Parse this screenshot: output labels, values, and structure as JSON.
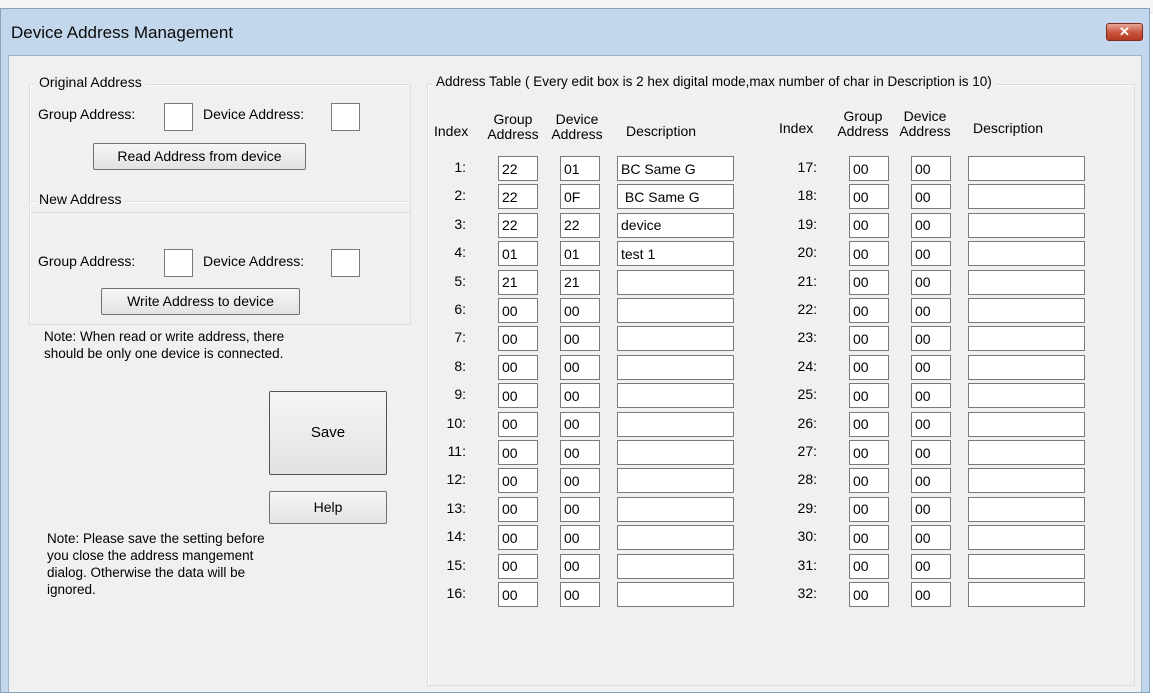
{
  "window": {
    "title": "Device Address Management",
    "close_glyph": "✕"
  },
  "original_address": {
    "legend": "Original Address",
    "group_label": "Group Address:",
    "group_value": "",
    "device_label": "Device Address:",
    "device_value": "",
    "read_button": "Read Address from device"
  },
  "new_address": {
    "legend": "New Address",
    "group_label": "Group Address:",
    "group_value": "",
    "device_label": "Device Address:",
    "device_value": "",
    "write_button": "Write Address to device"
  },
  "note1": [
    "Note: When read or write address, there",
    "should be only one device is connected."
  ],
  "save_button": "Save",
  "help_button": "Help",
  "note2": [
    "Note: Please save the setting before",
    "you close the address mangement",
    "dialog. Otherwise the data will be",
    "ignored."
  ],
  "address_table": {
    "legend": "Address Table ( Every edit box is 2 hex digital mode,max number of char in Description is 10)",
    "headers": {
      "index": "Index",
      "group_line1": "Group",
      "group_line2": "Address",
      "device_line1": "Device",
      "device_line2": "Address",
      "description": "Description"
    },
    "left_rows": [
      {
        "index": "1:",
        "group": "22",
        "device": "01",
        "desc": "BC Same G"
      },
      {
        "index": "2:",
        "group": "22",
        "device": "0F",
        "desc": " BC Same G"
      },
      {
        "index": "3:",
        "group": "22",
        "device": "22",
        "desc": "device"
      },
      {
        "index": "4:",
        "group": "01",
        "device": "01",
        "desc": "test 1"
      },
      {
        "index": "5:",
        "group": "21",
        "device": "21",
        "desc": ""
      },
      {
        "index": "6:",
        "group": "00",
        "device": "00",
        "desc": ""
      },
      {
        "index": "7:",
        "group": "00",
        "device": "00",
        "desc": ""
      },
      {
        "index": "8:",
        "group": "00",
        "device": "00",
        "desc": ""
      },
      {
        "index": "9:",
        "group": "00",
        "device": "00",
        "desc": ""
      },
      {
        "index": "10:",
        "group": "00",
        "device": "00",
        "desc": ""
      },
      {
        "index": "11:",
        "group": "00",
        "device": "00",
        "desc": ""
      },
      {
        "index": "12:",
        "group": "00",
        "device": "00",
        "desc": ""
      },
      {
        "index": "13:",
        "group": "00",
        "device": "00",
        "desc": ""
      },
      {
        "index": "14:",
        "group": "00",
        "device": "00",
        "desc": ""
      },
      {
        "index": "15:",
        "group": "00",
        "device": "00",
        "desc": ""
      },
      {
        "index": "16:",
        "group": "00",
        "device": "00",
        "desc": ""
      }
    ],
    "right_rows": [
      {
        "index": "17:",
        "group": "00",
        "device": "00",
        "desc": ""
      },
      {
        "index": "18:",
        "group": "00",
        "device": "00",
        "desc": ""
      },
      {
        "index": "19:",
        "group": "00",
        "device": "00",
        "desc": ""
      },
      {
        "index": "20:",
        "group": "00",
        "device": "00",
        "desc": ""
      },
      {
        "index": "21:",
        "group": "00",
        "device": "00",
        "desc": ""
      },
      {
        "index": "22:",
        "group": "00",
        "device": "00",
        "desc": ""
      },
      {
        "index": "23:",
        "group": "00",
        "device": "00",
        "desc": ""
      },
      {
        "index": "24:",
        "group": "00",
        "device": "00",
        "desc": ""
      },
      {
        "index": "25:",
        "group": "00",
        "device": "00",
        "desc": ""
      },
      {
        "index": "26:",
        "group": "00",
        "device": "00",
        "desc": ""
      },
      {
        "index": "27:",
        "group": "00",
        "device": "00",
        "desc": ""
      },
      {
        "index": "28:",
        "group": "00",
        "device": "00",
        "desc": ""
      },
      {
        "index": "29:",
        "group": "00",
        "device": "00",
        "desc": ""
      },
      {
        "index": "30:",
        "group": "00",
        "device": "00",
        "desc": ""
      },
      {
        "index": "31:",
        "group": "00",
        "device": "00",
        "desc": ""
      },
      {
        "index": "32:",
        "group": "00",
        "device": "00",
        "desc": ""
      }
    ]
  },
  "colors": {
    "title_bar": "#c3d7ec",
    "client_bg": "#f0f0f0",
    "close_button": "#c8543c"
  }
}
